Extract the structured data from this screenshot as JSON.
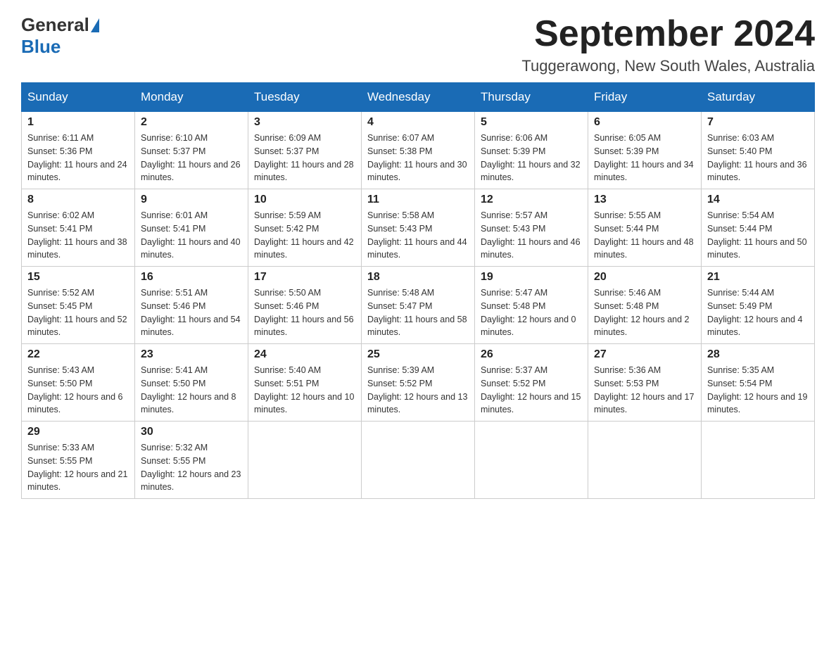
{
  "header": {
    "logo_general": "General",
    "logo_blue": "Blue",
    "month_title": "September 2024",
    "location": "Tuggerawong, New South Wales, Australia"
  },
  "days_of_week": [
    "Sunday",
    "Monday",
    "Tuesday",
    "Wednesday",
    "Thursday",
    "Friday",
    "Saturday"
  ],
  "weeks": [
    [
      {
        "day": "1",
        "sunrise": "6:11 AM",
        "sunset": "5:36 PM",
        "daylight": "11 hours and 24 minutes."
      },
      {
        "day": "2",
        "sunrise": "6:10 AM",
        "sunset": "5:37 PM",
        "daylight": "11 hours and 26 minutes."
      },
      {
        "day": "3",
        "sunrise": "6:09 AM",
        "sunset": "5:37 PM",
        "daylight": "11 hours and 28 minutes."
      },
      {
        "day": "4",
        "sunrise": "6:07 AM",
        "sunset": "5:38 PM",
        "daylight": "11 hours and 30 minutes."
      },
      {
        "day": "5",
        "sunrise": "6:06 AM",
        "sunset": "5:39 PM",
        "daylight": "11 hours and 32 minutes."
      },
      {
        "day": "6",
        "sunrise": "6:05 AM",
        "sunset": "5:39 PM",
        "daylight": "11 hours and 34 minutes."
      },
      {
        "day": "7",
        "sunrise": "6:03 AM",
        "sunset": "5:40 PM",
        "daylight": "11 hours and 36 minutes."
      }
    ],
    [
      {
        "day": "8",
        "sunrise": "6:02 AM",
        "sunset": "5:41 PM",
        "daylight": "11 hours and 38 minutes."
      },
      {
        "day": "9",
        "sunrise": "6:01 AM",
        "sunset": "5:41 PM",
        "daylight": "11 hours and 40 minutes."
      },
      {
        "day": "10",
        "sunrise": "5:59 AM",
        "sunset": "5:42 PM",
        "daylight": "11 hours and 42 minutes."
      },
      {
        "day": "11",
        "sunrise": "5:58 AM",
        "sunset": "5:43 PM",
        "daylight": "11 hours and 44 minutes."
      },
      {
        "day": "12",
        "sunrise": "5:57 AM",
        "sunset": "5:43 PM",
        "daylight": "11 hours and 46 minutes."
      },
      {
        "day": "13",
        "sunrise": "5:55 AM",
        "sunset": "5:44 PM",
        "daylight": "11 hours and 48 minutes."
      },
      {
        "day": "14",
        "sunrise": "5:54 AM",
        "sunset": "5:44 PM",
        "daylight": "11 hours and 50 minutes."
      }
    ],
    [
      {
        "day": "15",
        "sunrise": "5:52 AM",
        "sunset": "5:45 PM",
        "daylight": "11 hours and 52 minutes."
      },
      {
        "day": "16",
        "sunrise": "5:51 AM",
        "sunset": "5:46 PM",
        "daylight": "11 hours and 54 minutes."
      },
      {
        "day": "17",
        "sunrise": "5:50 AM",
        "sunset": "5:46 PM",
        "daylight": "11 hours and 56 minutes."
      },
      {
        "day": "18",
        "sunrise": "5:48 AM",
        "sunset": "5:47 PM",
        "daylight": "11 hours and 58 minutes."
      },
      {
        "day": "19",
        "sunrise": "5:47 AM",
        "sunset": "5:48 PM",
        "daylight": "12 hours and 0 minutes."
      },
      {
        "day": "20",
        "sunrise": "5:46 AM",
        "sunset": "5:48 PM",
        "daylight": "12 hours and 2 minutes."
      },
      {
        "day": "21",
        "sunrise": "5:44 AM",
        "sunset": "5:49 PM",
        "daylight": "12 hours and 4 minutes."
      }
    ],
    [
      {
        "day": "22",
        "sunrise": "5:43 AM",
        "sunset": "5:50 PM",
        "daylight": "12 hours and 6 minutes."
      },
      {
        "day": "23",
        "sunrise": "5:41 AM",
        "sunset": "5:50 PM",
        "daylight": "12 hours and 8 minutes."
      },
      {
        "day": "24",
        "sunrise": "5:40 AM",
        "sunset": "5:51 PM",
        "daylight": "12 hours and 10 minutes."
      },
      {
        "day": "25",
        "sunrise": "5:39 AM",
        "sunset": "5:52 PM",
        "daylight": "12 hours and 13 minutes."
      },
      {
        "day": "26",
        "sunrise": "5:37 AM",
        "sunset": "5:52 PM",
        "daylight": "12 hours and 15 minutes."
      },
      {
        "day": "27",
        "sunrise": "5:36 AM",
        "sunset": "5:53 PM",
        "daylight": "12 hours and 17 minutes."
      },
      {
        "day": "28",
        "sunrise": "5:35 AM",
        "sunset": "5:54 PM",
        "daylight": "12 hours and 19 minutes."
      }
    ],
    [
      {
        "day": "29",
        "sunrise": "5:33 AM",
        "sunset": "5:55 PM",
        "daylight": "12 hours and 21 minutes."
      },
      {
        "day": "30",
        "sunrise": "5:32 AM",
        "sunset": "5:55 PM",
        "daylight": "12 hours and 23 minutes."
      },
      null,
      null,
      null,
      null,
      null
    ]
  ],
  "labels": {
    "sunrise": "Sunrise: ",
    "sunset": "Sunset: ",
    "daylight": "Daylight: "
  }
}
